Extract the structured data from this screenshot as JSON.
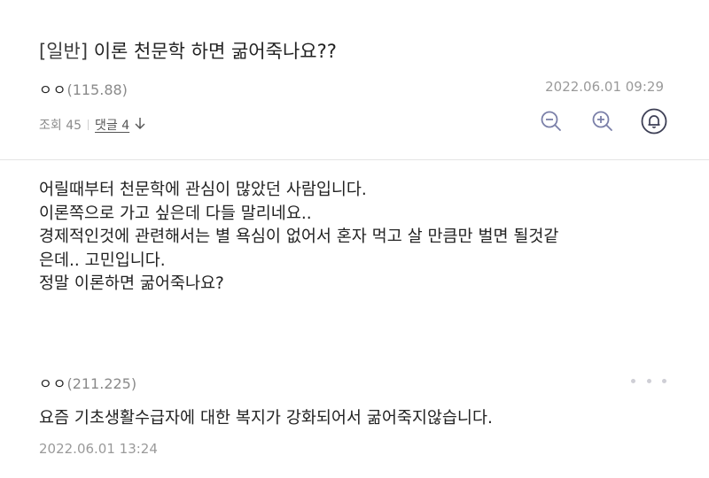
{
  "post": {
    "category": "[일반]",
    "title": "이론 천문학 하면 굶어죽나요??",
    "author_nick": "ㅇㅇ",
    "author_ip": "(115.88)",
    "date": "2022.06.01 09:29",
    "views": "조회 45",
    "comments_link": "댓글 4",
    "body_lines": [
      "어릴때부터 천문학에 관심이 많았던 사람입니다.",
      "이론쪽으로 가고 싶은데 다들 말리네요..",
      "경제적인것에 관련해서는 별 욕심이 없어서 혼자 먹고 살 만큼만 벌면 될것같",
      "은데.. 고민입니다.",
      "정말 이론하면 굶어죽나요?"
    ]
  },
  "icons": {
    "zoom_out": "zoom-out-icon",
    "zoom_in": "zoom-in-icon",
    "alarm": "bell-icon",
    "comments_arrow": "arrow-down-icon",
    "more": "more-options-icon"
  },
  "colors": {
    "icon": "#7a7fa8",
    "bell": "#3d3f55"
  },
  "comment": {
    "author_nick": "ㅇㅇ",
    "author_ip": "(211.225)",
    "text": "요즘 기초생활수급자에 대한 복지가 강화되어서 굶어죽지않습니다.",
    "date": "2022.06.01 13:24"
  }
}
